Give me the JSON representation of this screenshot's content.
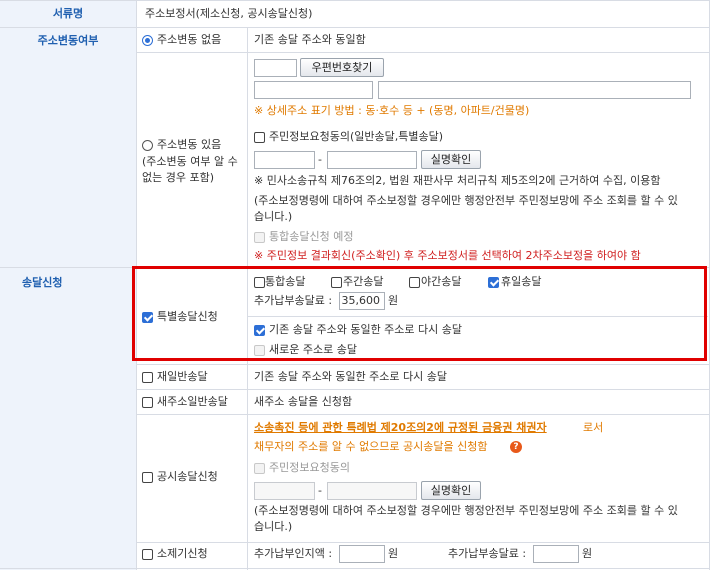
{
  "rows": {
    "doc_type": {
      "label": "서류명",
      "value": "주소보정서(제소신청, 공시송달신청)"
    },
    "addr_change": {
      "label": "주소변동여부",
      "no_change_label": "주소변동 없음",
      "no_change_desc": "기존 송달 주소와 동일함",
      "change_label": "주소변동 있음",
      "change_sub1": "(주소변동 여부 알 수",
      "change_sub2": "없는 경우 포함)",
      "zip_button": "우편번호찾기",
      "addr_note": "※ 상세주소 표기 방법 : 동·호수 등 + (동명, 아파트/건물명)",
      "consent_label": "주민정보요청동의(일반송달,특별송달)",
      "dash": "-",
      "verify_button": "실명확인",
      "law_note": "※ 민사소송규칙 제76조의2, 법원 재판사무 처리규칙 제5조의2에 근거하여 수집, 이용함",
      "gov_note1": "(주소보정명령에 대하여 주소보정할 경우에만 행정안전부 주민정보망에 주소 조회를 할 수 있",
      "gov_note2": "습니다.)",
      "combined_label": "통합송달신청 예정",
      "warn_note": "※ 주민정보 결과회신(주소확인) 후 주소보정서를 선택하여 2차주소보정을 하여야 함"
    },
    "service": {
      "label": "송달신청",
      "special": {
        "label": "특별송달신청",
        "opt_combined": "통합송달",
        "opt_night": "주간송달",
        "opt_evening": "야간송달",
        "opt_holiday": "휴일송달",
        "fee_label": "추가납부송달료 :",
        "fee_value": "35,600",
        "fee_unit": "원",
        "same_addr": "기존 송달 주소와 동일한 주소로 다시 송달",
        "new_addr": "새로운 주소로 송달"
      },
      "resend": {
        "label": "재일반송달",
        "desc": "기존 송달 주소와 동일한 주소로 다시 송달"
      },
      "new_general": {
        "label": "새주소일반송달",
        "desc": "새주소 송달을 신청함"
      },
      "public": {
        "label": "공시송달신청",
        "law_link": "소송촉진 등에 관한 특례법 제20조의2에 규정된 금융권 채권자",
        "law_suffix": "로서",
        "desc": "채무자의 주소를 알 수 없으므로 공시송달을 신청함",
        "help_icon": "?",
        "consent_label": "주민정보요청동의",
        "dash": "-",
        "verify_button": "실명확인",
        "gov_note1": "(주소보정명령에 대하여 주소보정할 경우에만 행정안전부 주민정보망에 주소 조회를 할 수 있",
        "gov_note2": "습니다.)"
      },
      "withdraw": {
        "label": "소제기신청",
        "stamp_label": "추가납부인지액 :",
        "stamp_unit": "원",
        "fee_label": "추가납부송달료 :",
        "fee_unit": "원"
      }
    }
  },
  "colors": {
    "header_bg": "#eef3fb",
    "header_text": "#2060b0",
    "highlight_border": "#e00000",
    "orange": "#e07a00",
    "red": "#d02020"
  }
}
